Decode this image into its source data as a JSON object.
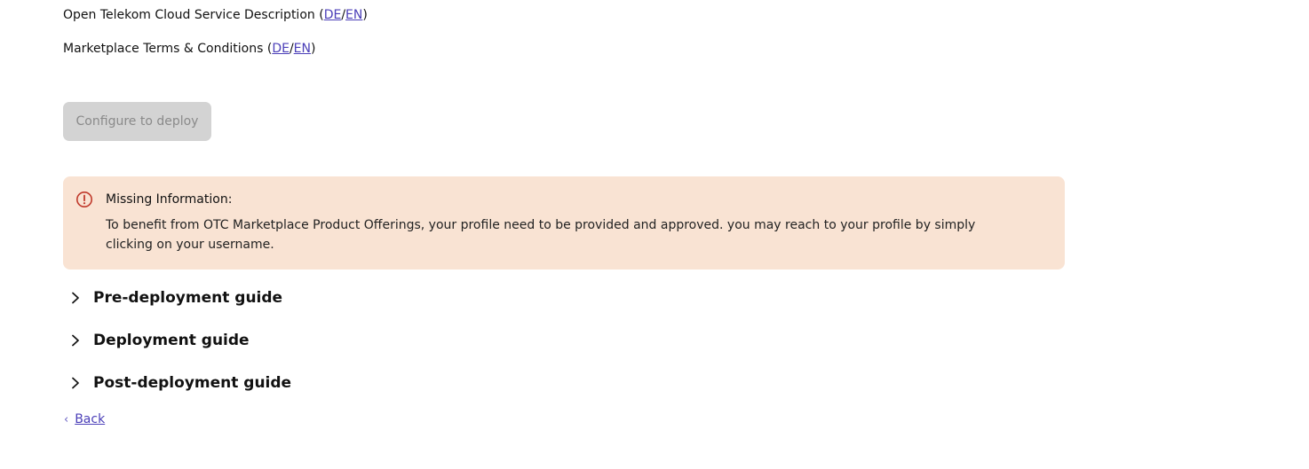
{
  "documents": {
    "service_description": {
      "label": "Open Telekom Cloud Service Description",
      "link_de": "DE",
      "link_en": "EN"
    },
    "terms": {
      "label": "Marketplace Terms & Conditions",
      "link_de": "DE",
      "link_en": "EN"
    }
  },
  "configure_button": {
    "label": "Configure to deploy",
    "state": "disabled"
  },
  "alert": {
    "icon": "exclamation-circle-icon",
    "title": "Missing Information:",
    "message": "To benefit from OTC Marketplace Product Offerings, your profile need to be provided and approved. you may reach to your profile by simply clicking on your username.",
    "background_color": "#f9e3d3",
    "icon_color": "#c0392b"
  },
  "guides": [
    {
      "label": "Pre-deployment guide",
      "expanded": false
    },
    {
      "label": "Deployment guide",
      "expanded": false
    },
    {
      "label": "Post-deployment guide",
      "expanded": false
    }
  ],
  "back_link": {
    "label": "Back",
    "icon": "chevron-left-icon"
  },
  "colors": {
    "link": "#4b3fb8",
    "button_disabled_bg": "#d3d3d3",
    "button_disabled_text": "#8a8a8a"
  }
}
